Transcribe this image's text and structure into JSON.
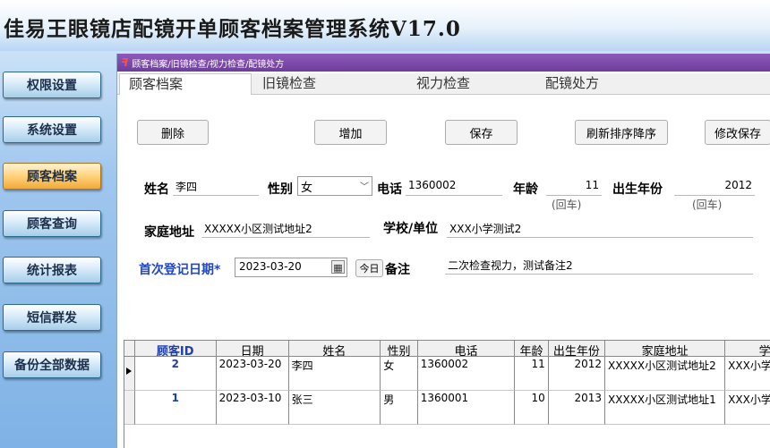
{
  "app": {
    "title": "佳易王眼镜店配镜开单顾客档案管理系统V17.0"
  },
  "sidebar": {
    "items": [
      {
        "label": "权限设置",
        "active": false
      },
      {
        "label": "系统设置",
        "active": false
      },
      {
        "label": "顾客档案",
        "active": true
      },
      {
        "label": "顾客查询",
        "active": false
      },
      {
        "label": "统计报表",
        "active": false
      },
      {
        "label": "短信群发",
        "active": false
      },
      {
        "label": "备份全部数据",
        "active": false
      }
    ]
  },
  "panel": {
    "header_icon": "ꟻ",
    "title": "顾客档案/旧镜检查/视力检查/配镜处方"
  },
  "tabs": [
    "顾客档案",
    "旧镜检查",
    "视力检查",
    "配镜处方"
  ],
  "toolbar": {
    "delete": "删除",
    "add": "增加",
    "save": "保存",
    "refresh_sort": "刷新排序降序",
    "modify_save": "修改保存"
  },
  "form": {
    "name_label": "姓名",
    "name_value": "李四",
    "gender_label": "性别",
    "gender_value": "女",
    "phone_label": "电话",
    "phone_value": "1360002",
    "age_label": "年龄",
    "age_value": "11",
    "age_hint": "(回车)",
    "birth_label": "出生年份",
    "birth_value": "2012",
    "birth_hint": "(回车)",
    "address_label": "家庭地址",
    "address_value": "XXXXX小区测试地址2",
    "school_label": "学校/单位",
    "school_value": "XXX小学测试2",
    "firstdate_label": "首次登记日期*",
    "firstdate_value": "2023-03-20",
    "calendar_icon": "▦",
    "today_label": "今日",
    "remark_label": "备注",
    "remark_value": "二次检查视力，测试备注2"
  },
  "table": {
    "headers": [
      "顾客ID",
      "日期",
      "姓名",
      "性别",
      "电话",
      "年龄",
      "出生年份",
      "家庭地址",
      "学"
    ],
    "rows": [
      [
        "2",
        "2023-03-20",
        "李四",
        "女",
        "1360002",
        "11",
        "2012",
        "XXXXX小区测试地址2",
        "XXX小学"
      ],
      [
        "1",
        "2023-03-10",
        "张三",
        "男",
        "1360001",
        "10",
        "2013",
        "XXXXX小区测试地址1",
        "XXX小学"
      ]
    ]
  },
  "colors": {
    "accent_purple": "#6e3d9c",
    "active_orange": "#f2a93b",
    "link_blue": "#1f3fb0"
  }
}
